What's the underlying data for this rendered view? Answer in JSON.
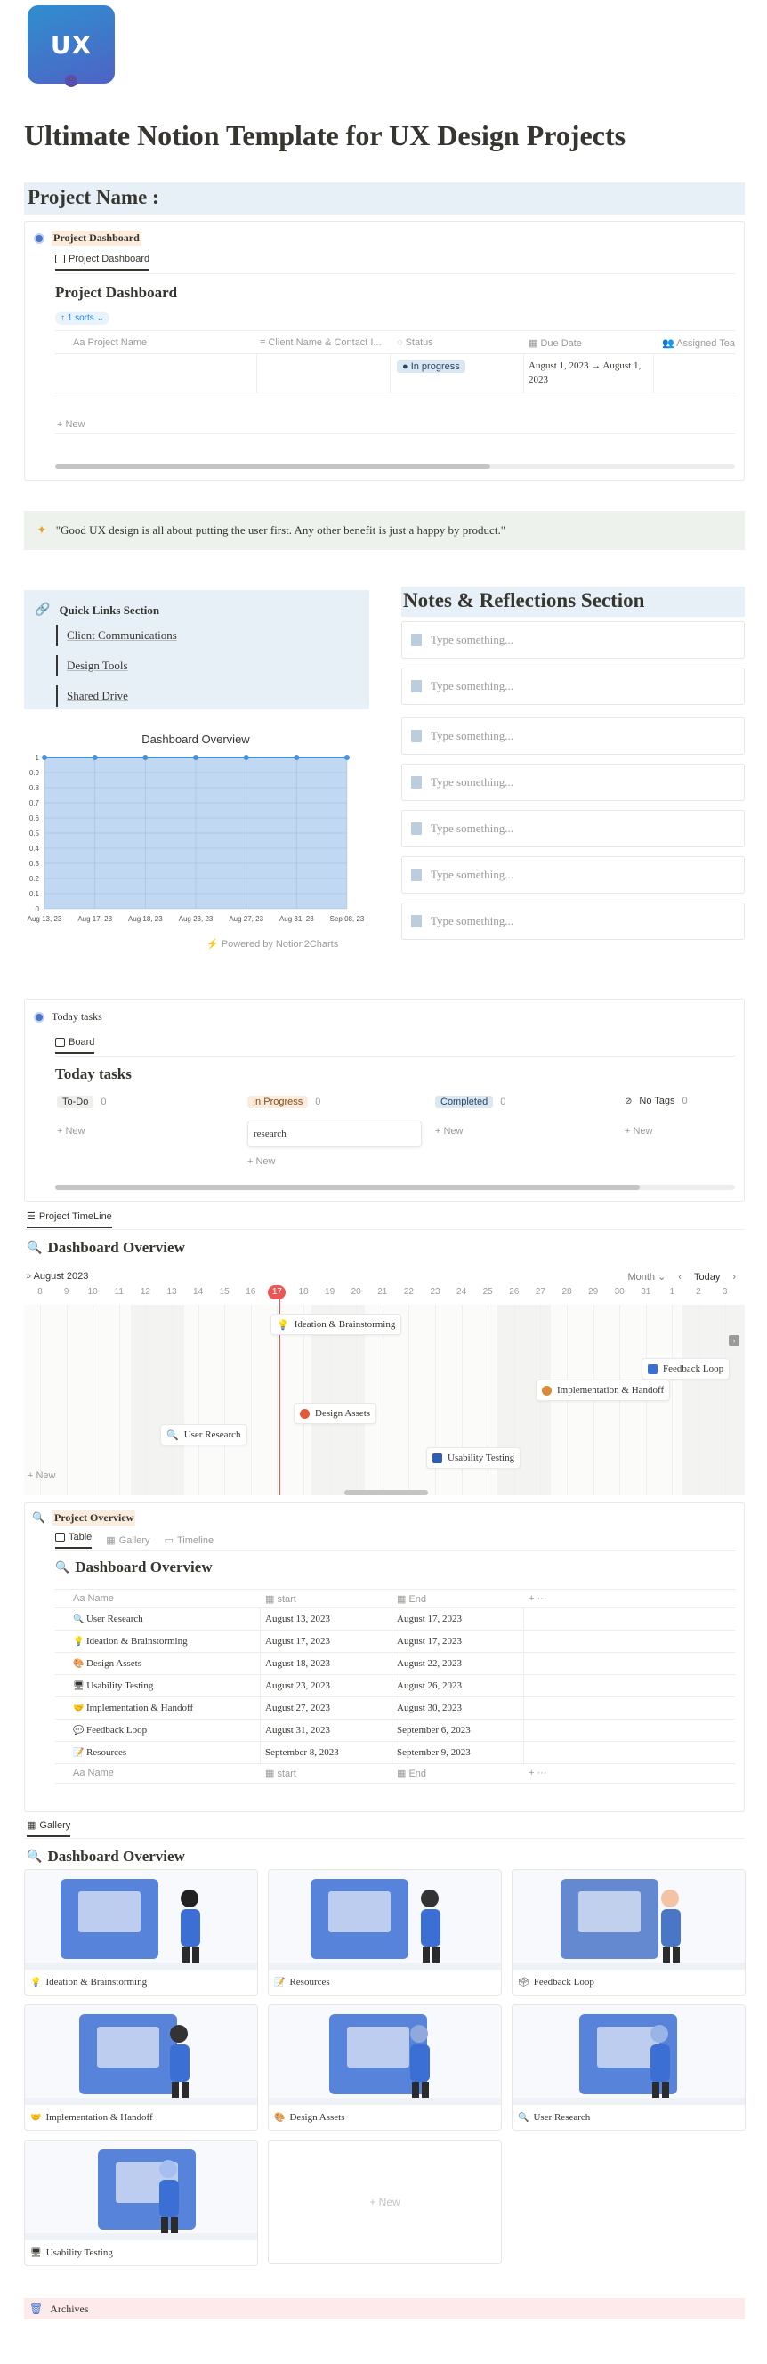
{
  "logo_text": "UX",
  "title": "Ultimate Notion Template for UX Design Projects",
  "project_name_heading": "Project Name :",
  "project_dashboard": {
    "link_label": "Project Dashboard",
    "view_tab": "Project Dashboard",
    "db_title": "Project Dashboard",
    "sorts_label": "1 sorts",
    "columns": [
      "Project Name",
      "Client Name & Contact I...",
      "Status",
      "Due Date",
      "Assigned Tea"
    ],
    "row": {
      "status": "In progress",
      "due": "August 1, 2023 → August 1, 2023"
    },
    "new_label": "New"
  },
  "quote": "\"Good UX design is all about putting the user first. Any other benefit is just a happy by product.\"",
  "quick_links": {
    "title": "Quick Links Section",
    "links": [
      "Client Communications",
      "Design Tools",
      "Shared Drive"
    ]
  },
  "notes": {
    "title": "Notes & Reflections Section",
    "placeholder": "Type something...",
    "rows": [
      "Type something...",
      "Type something...",
      "Type something...",
      "Type something...",
      "Type something...",
      "Type something...",
      "Type something..."
    ]
  },
  "chart_footer": "Powered by Notion2Charts",
  "chart_data": {
    "type": "area",
    "title": "Dashboard Overview",
    "x": [
      "Aug 13, 23",
      "Aug 17, 23",
      "Aug 18, 23",
      "Aug 23, 23",
      "Aug 27, 23",
      "Aug 31, 23",
      "Sep 08, 23"
    ],
    "values": [
      1,
      1,
      1,
      1,
      1,
      1,
      1
    ],
    "y_ticks": [
      "0",
      "0.1",
      "0.2",
      "0.3",
      "0.4",
      "0.5",
      "0.6",
      "0.7",
      "0.8",
      "0.9",
      "1"
    ],
    "ylim": [
      0,
      1
    ],
    "grid": true,
    "color": "#4a90d9"
  },
  "today_tasks": {
    "link_label": "Today tasks",
    "view_tab": "Board",
    "db_title": "Today tasks",
    "columns": [
      {
        "label": "To-Do",
        "count": "0",
        "bg": "#eeeeec",
        "fg": "#37352f"
      },
      {
        "label": "In Progress",
        "count": "0",
        "bg": "#fbecdd",
        "fg": "#8a4a14"
      },
      {
        "label": "Completed",
        "count": "0",
        "bg": "#dbe7f1",
        "fg": "#28456c"
      },
      {
        "label": "No Tags",
        "count": "0",
        "bg": "transparent",
        "fg": "#37352f"
      }
    ],
    "card_text": "research",
    "new_label": "New"
  },
  "timeline": {
    "tab": "Project TimeLine",
    "title": "Dashboard Overview",
    "month_label": "August 2023",
    "view_mode": "Month",
    "today_label": "Today",
    "days": [
      "8",
      "9",
      "10",
      "11",
      "12",
      "13",
      "14",
      "15",
      "16",
      "17",
      "18",
      "19",
      "20",
      "21",
      "22",
      "23",
      "24",
      "25",
      "26",
      "27",
      "28",
      "29",
      "30",
      "31",
      "1",
      "2",
      "3"
    ],
    "today_day": "17",
    "items": [
      "Ideation & Brainstorming",
      "Feedback Loop",
      "Implementation & Handoff",
      "Design Assets",
      "User Research",
      "Usability Testing"
    ],
    "new_label": "New"
  },
  "project_overview": {
    "link_label": "Project Overview",
    "tabs": [
      "Table",
      "Gallery",
      "Timeline"
    ],
    "db_title": "Dashboard Overview",
    "columns": [
      "Name",
      "start",
      "End"
    ],
    "rows": [
      {
        "name": "User Research",
        "start": "August 13, 2023",
        "end": "August 17, 2023"
      },
      {
        "name": "Ideation & Brainstorming",
        "start": "August 17, 2023",
        "end": "August 17, 2023"
      },
      {
        "name": "Design Assets",
        "start": "August 18, 2023",
        "end": "August 22, 2023"
      },
      {
        "name": "Usability Testing",
        "start": "August 23, 2023",
        "end": "August 26, 2023"
      },
      {
        "name": "Implementation & Handoff",
        "start": "August 27, 2023",
        "end": "August 30, 2023"
      },
      {
        "name": "Feedback Loop",
        "start": "August 31, 2023",
        "end": "September 6, 2023"
      },
      {
        "name": "Resources",
        "start": "September 8, 2023",
        "end": "September 9, 2023"
      }
    ]
  },
  "gallery": {
    "tab": "Gallery",
    "title": "Dashboard Overview",
    "cards": [
      "Ideation & Brainstorming",
      "Resources",
      "Feedback Loop",
      "Implementation & Handoff",
      "Design Assets",
      "User Research",
      "Usability Testing"
    ],
    "new_label": "New"
  },
  "archives": "Archives"
}
